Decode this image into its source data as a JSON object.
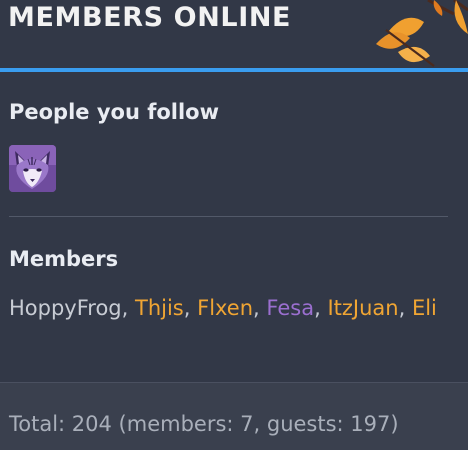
{
  "header": {
    "title": "MEMBERS ONLINE",
    "accent_color": "#3a9df0",
    "decoration_icon": "autumn-leaves-icon"
  },
  "following": {
    "title": "People you follow",
    "avatar_icon": "fox-avatar-icon"
  },
  "members": {
    "title": "Members",
    "list": [
      {
        "name": "HoppyFrog",
        "color": "#c8ccd4"
      },
      {
        "name": "Thjis",
        "color": "#f0a533"
      },
      {
        "name": "Flxen",
        "color": "#f0a533"
      },
      {
        "name": "Fesa",
        "color": "#9b6fd0"
      },
      {
        "name": "ItzJuan",
        "color": "#f0a533"
      },
      {
        "name": "Eli",
        "color": "#f0a533"
      }
    ],
    "separator": ", "
  },
  "footer": {
    "total_text": "Total: 204 (members: 7, guests: 197)"
  }
}
